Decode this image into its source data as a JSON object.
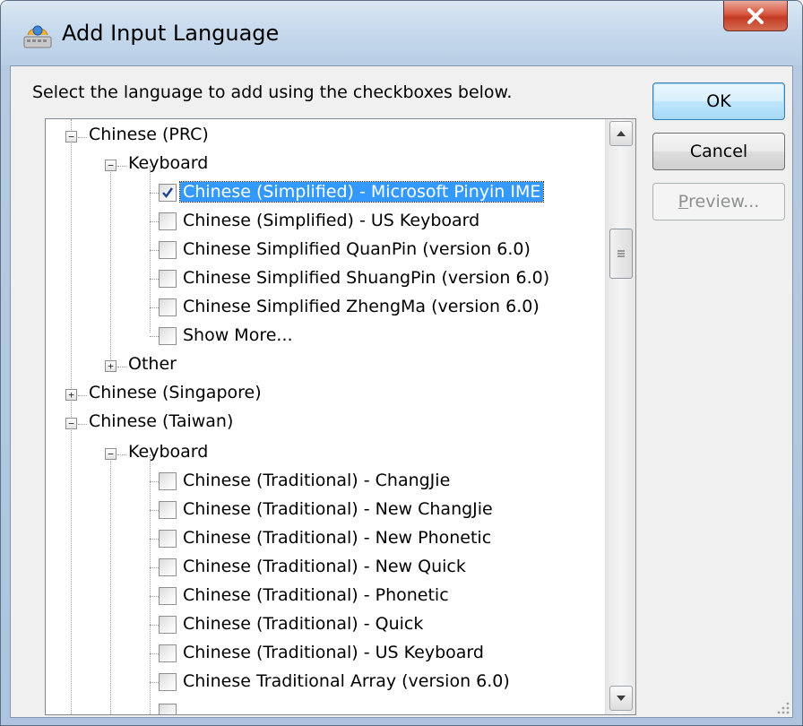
{
  "window": {
    "title": "Add Input Language",
    "close_label": "X"
  },
  "instruction": "Select the language to add using the checkboxes below.",
  "buttons": {
    "ok": "OK",
    "cancel": "Cancel",
    "preview_accel": "P",
    "preview_rest": "review..."
  },
  "tree": {
    "prc": {
      "label": "Chinese (PRC)",
      "keyboard": "Keyboard",
      "items": [
        {
          "label": "Chinese (Simplified) - Microsoft Pinyin IME",
          "checked": true,
          "selected": true
        },
        {
          "label": "Chinese (Simplified) - US Keyboard",
          "checked": false
        },
        {
          "label": "Chinese Simplified QuanPin (version 6.0)",
          "checked": false
        },
        {
          "label": "Chinese Simplified ShuangPin (version 6.0)",
          "checked": false
        },
        {
          "label": "Chinese Simplified ZhengMa (version 6.0)",
          "checked": false
        },
        {
          "label": "Show More...",
          "checked": false
        }
      ],
      "other": "Other"
    },
    "singapore": {
      "label": "Chinese (Singapore)"
    },
    "taiwan": {
      "label": "Chinese (Taiwan)",
      "keyboard": "Keyboard",
      "items": [
        {
          "label": "Chinese (Traditional) - ChangJie",
          "checked": false
        },
        {
          "label": "Chinese (Traditional) - New ChangJie",
          "checked": false
        },
        {
          "label": "Chinese (Traditional) - New Phonetic",
          "checked": false
        },
        {
          "label": "Chinese (Traditional) - New Quick",
          "checked": false
        },
        {
          "label": "Chinese (Traditional) - Phonetic",
          "checked": false
        },
        {
          "label": "Chinese (Traditional) - Quick",
          "checked": false
        },
        {
          "label": "Chinese (Traditional) - US Keyboard",
          "checked": false
        },
        {
          "label": "Chinese Traditional Array (version 6.0)",
          "checked": false
        }
      ]
    }
  },
  "colors": {
    "selection": "#3399ff",
    "close_button": "#c43b24",
    "default_button_border": "#3c7fb1"
  }
}
